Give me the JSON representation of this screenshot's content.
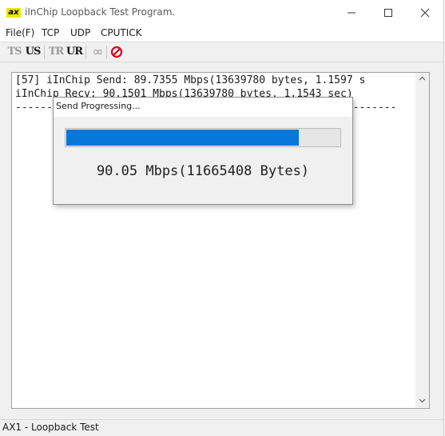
{
  "window": {
    "title": "iInChip Loopback Test Program.",
    "icon_label": "ax",
    "icon_color": "#f2e600"
  },
  "menu": [
    "File(F)",
    "TCP",
    "UDP",
    "CPUTICK"
  ],
  "toolbar": [
    {
      "label": "TS",
      "icon": "tcp-server-icon",
      "enabled": false
    },
    {
      "label": "US",
      "icon": "udp-server-icon",
      "enabled": true
    },
    {
      "label": "TR",
      "icon": "tcp-receive-icon",
      "enabled": false
    },
    {
      "label": "UR",
      "icon": "udp-receive-icon",
      "enabled": true
    },
    {
      "label": "∞",
      "icon": "loop-icon",
      "enabled": false
    },
    {
      "label": "⊘",
      "icon": "stop-icon",
      "enabled": true
    }
  ],
  "log": {
    "lines": [
      "[57] iInChip Send: 89.7355 Mbps(13639780 bytes, 1.1597 s",
      "iInChip Recv: 90.1501 Mbps(13639780 bytes, 1.1543 sec)",
      "-------------------------------------------------------------"
    ]
  },
  "dialog": {
    "title": "Send Progressing...",
    "progress": 0.85,
    "rate_text": "90.05 Mbps(11665408 Bytes)"
  },
  "status": {
    "text": "AX1 - Loopback Test"
  },
  "colors": {
    "accent": "#0678d7",
    "stop": "#e0001a"
  }
}
